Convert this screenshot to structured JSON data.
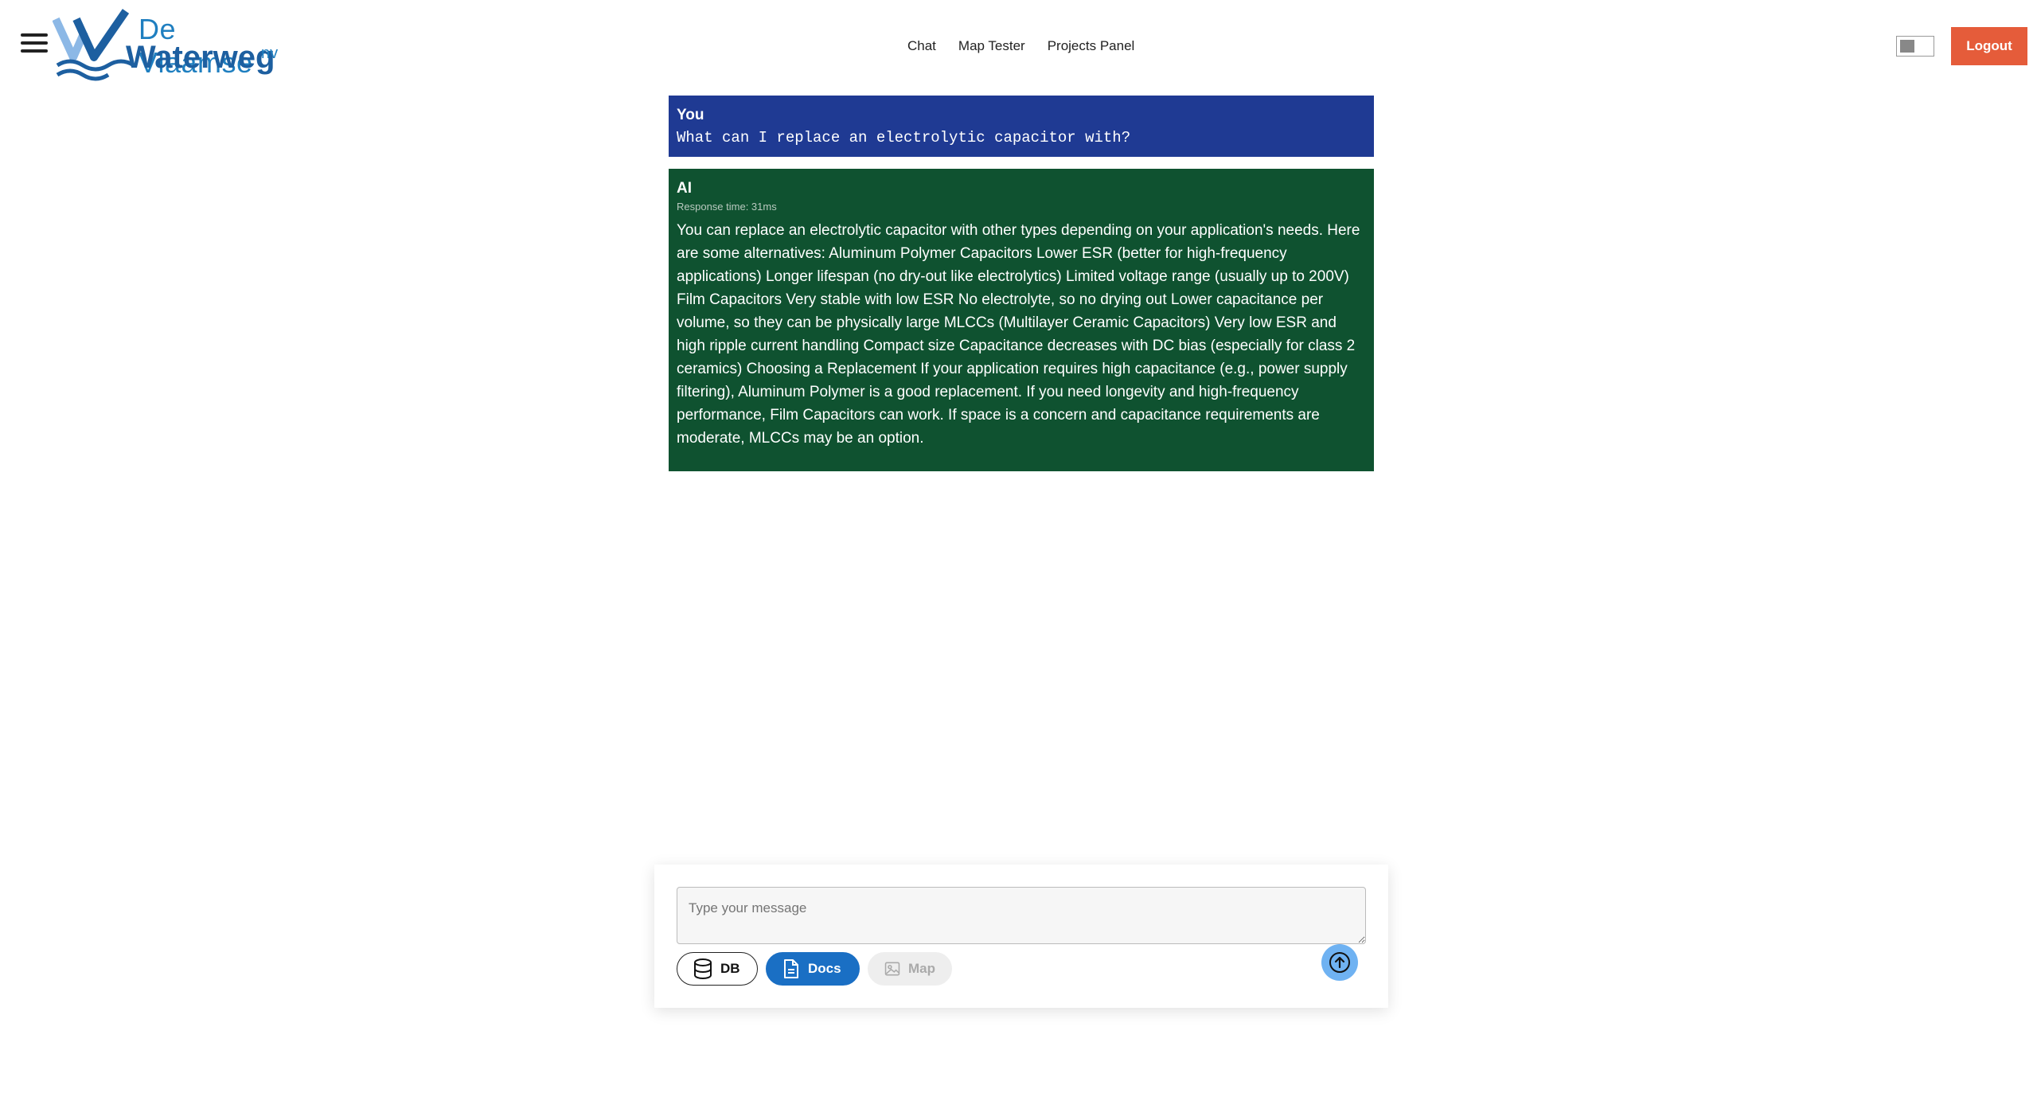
{
  "header": {
    "logo": {
      "line1": "De Vlaamse",
      "line2": "Waterweg",
      "suffix": "nv"
    },
    "nav": [
      {
        "label": "Chat"
      },
      {
        "label": "Map Tester"
      },
      {
        "label": "Projects Panel"
      }
    ],
    "logout_label": "Logout",
    "colors": {
      "logout": "#e55c3a",
      "logo_blue": "#1f7fc0"
    }
  },
  "chat": {
    "user_message": {
      "sender": "You",
      "text": "What can I replace an electrolytic capacitor with?"
    },
    "ai_message": {
      "sender": "AI",
      "response_time": "Response time: 31ms",
      "text": "You can replace an electrolytic capacitor with other types depending on your application's needs. Here are some alternatives: Aluminum Polymer Capacitors Lower ESR (better for high-frequency applications) Longer lifespan (no dry-out like electrolytics) Limited voltage range (usually up to 200V) Film Capacitors Very stable with low ESR No electrolyte, so no drying out Lower capacitance per volume, so they can be physically large MLCCs (Multilayer Ceramic Capacitors) Very low ESR and high ripple current handling Compact size Capacitance decreases with DC bias (especially for class 2 ceramics) Choosing a Replacement If your application requires high capacitance (e.g., power supply filtering), Aluminum Polymer is a good replacement. If you need longevity and high-frequency performance, Film Capacitors can work. If space is a concern and capacitance requirements are moderate, MLCCs may be an option."
    },
    "colors": {
      "user_bg": "#1f3a93",
      "ai_bg": "#0f5230"
    }
  },
  "composer": {
    "placeholder": "Type your message",
    "buttons": {
      "db": "DB",
      "docs": "Docs",
      "map": "Map"
    },
    "icons": {
      "db": "database-icon",
      "docs": "document-icon",
      "map": "image-icon",
      "send": "arrow-up-circle-icon"
    }
  }
}
